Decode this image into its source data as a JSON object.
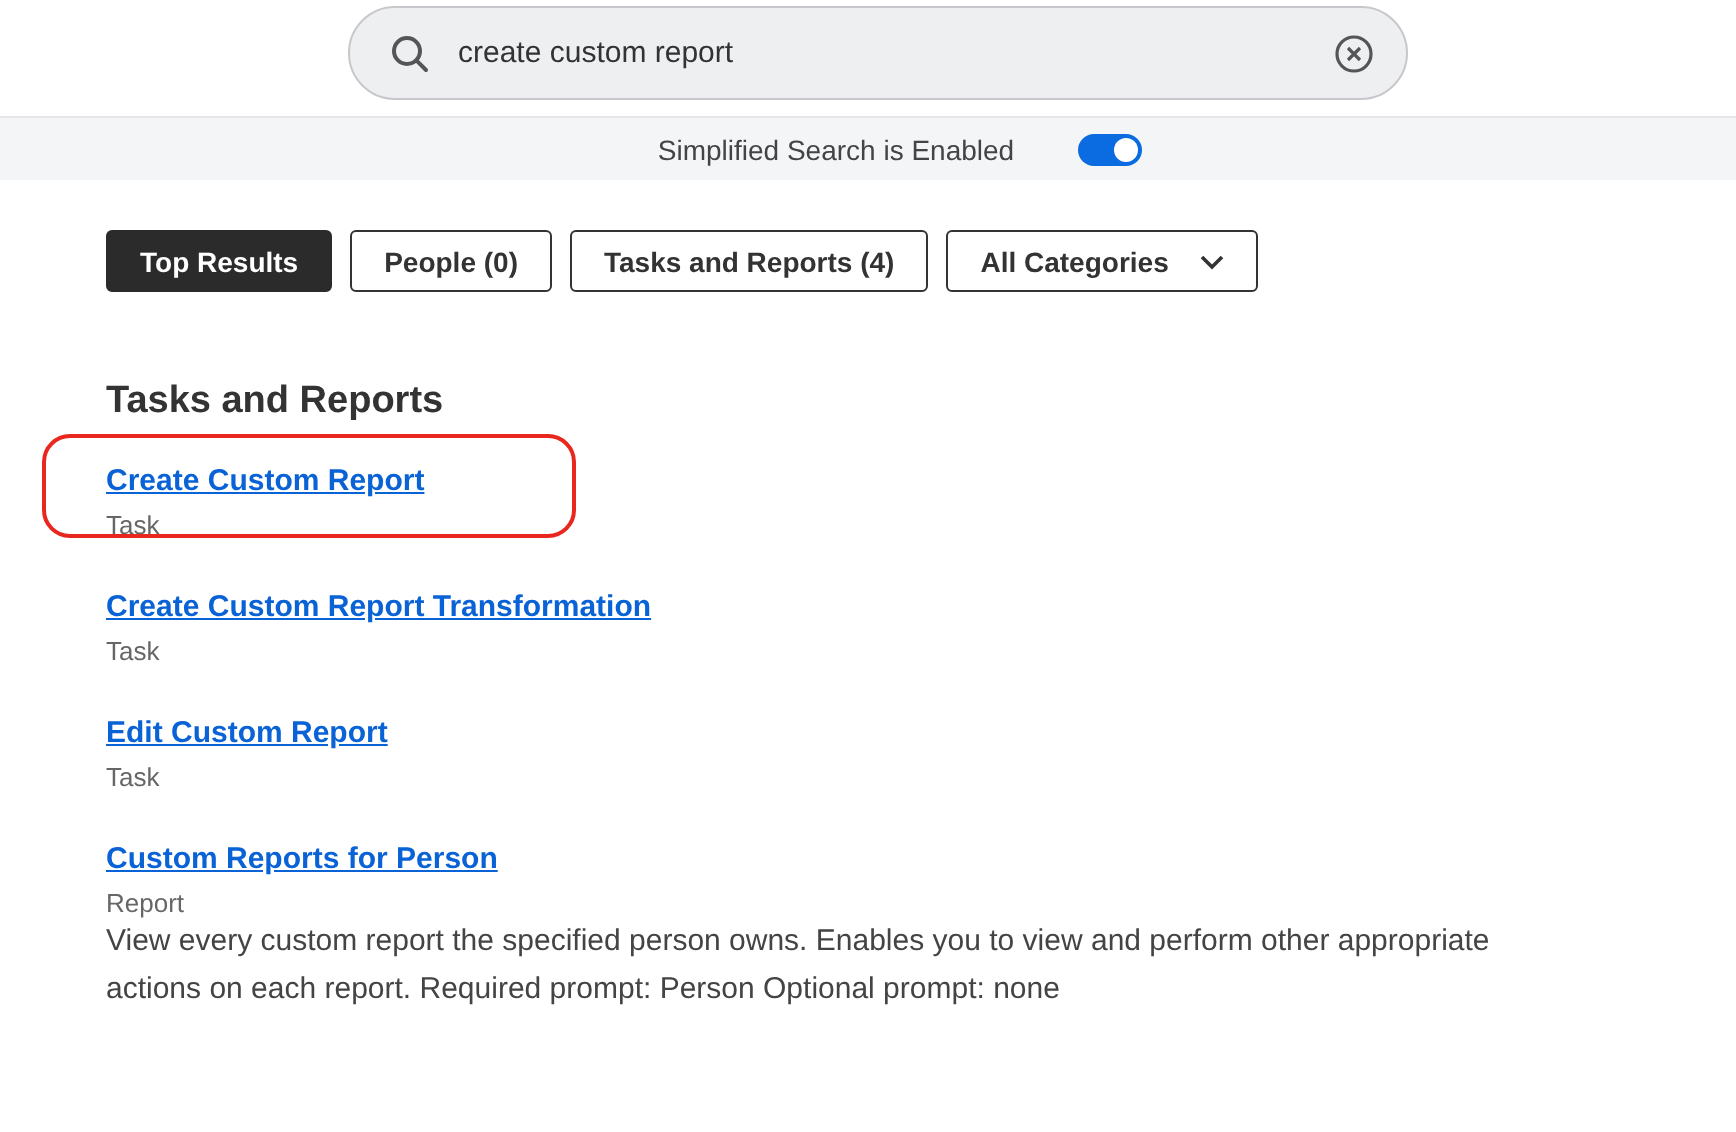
{
  "search": {
    "value": "create custom report"
  },
  "simplified_search": {
    "label": "Simplified Search is Enabled",
    "on": true
  },
  "filters": [
    {
      "label": "Top Results",
      "selected": true,
      "kind": "tab"
    },
    {
      "label": "People (0)",
      "selected": false,
      "kind": "tab"
    },
    {
      "label": "Tasks and Reports (4)",
      "selected": false,
      "kind": "tab"
    },
    {
      "label": "All Categories",
      "selected": false,
      "kind": "dropdown"
    }
  ],
  "section": {
    "title": "Tasks and Reports",
    "results": [
      {
        "title": "Create Custom Report",
        "type": "Task",
        "highlighted": true
      },
      {
        "title": "Create Custom Report Transformation",
        "type": "Task",
        "highlighted": false
      },
      {
        "title": "Edit Custom Report",
        "type": "Task",
        "highlighted": false
      },
      {
        "title": "Custom Reports for Person",
        "type": "Report",
        "highlighted": false,
        "description": "View every custom report the specified person owns. Enables you to view and perform other appropriate actions on each report. Required prompt: Person Optional prompt: none"
      }
    ]
  }
}
